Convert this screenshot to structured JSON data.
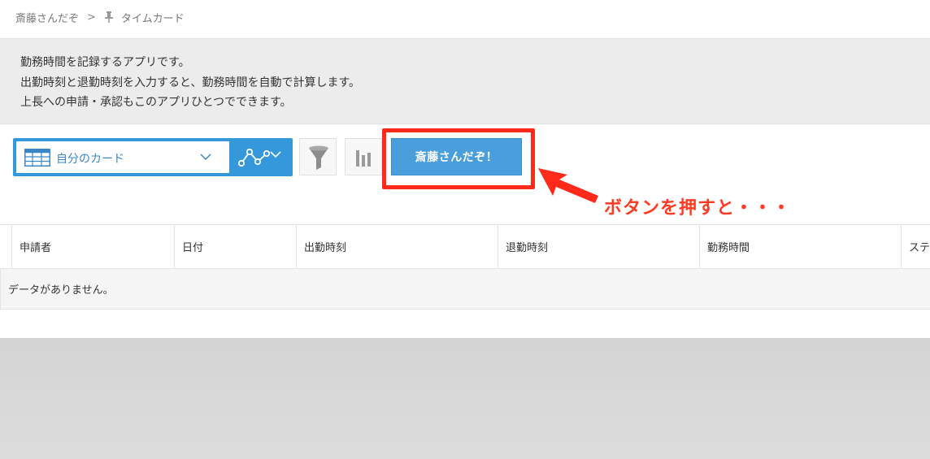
{
  "breadcrumb": {
    "space": "斎藤さんだぞ",
    "separator": ">",
    "app": "タイムカード"
  },
  "description": {
    "lines": [
      "勤務時間を記録するアプリです。",
      "出勤時刻と退勤時刻を入力すると、勤務時間を自動で計算します。",
      "上長への申請・承認もこのアプリひとつでできます。"
    ]
  },
  "toolbar": {
    "view_label": "自分のカード",
    "custom_button_label": "斎藤さんだぞ！"
  },
  "annotation": {
    "text": "ボタンを押すと・・・"
  },
  "table": {
    "columns": [
      "申請者",
      "日付",
      "出勤時刻",
      "退勤時刻",
      "勤務時間",
      "ステ"
    ],
    "empty_message": "データがありません。"
  },
  "colors": {
    "accent": "#3498db",
    "highlight": "#ff2a1a",
    "annotation": "#ff3a22"
  },
  "icons": {
    "breadcrumb": "pin-icon",
    "view": "table-icon",
    "graph": "graph-icon",
    "filter": "filter-icon",
    "chart": "bar-chart-icon"
  }
}
